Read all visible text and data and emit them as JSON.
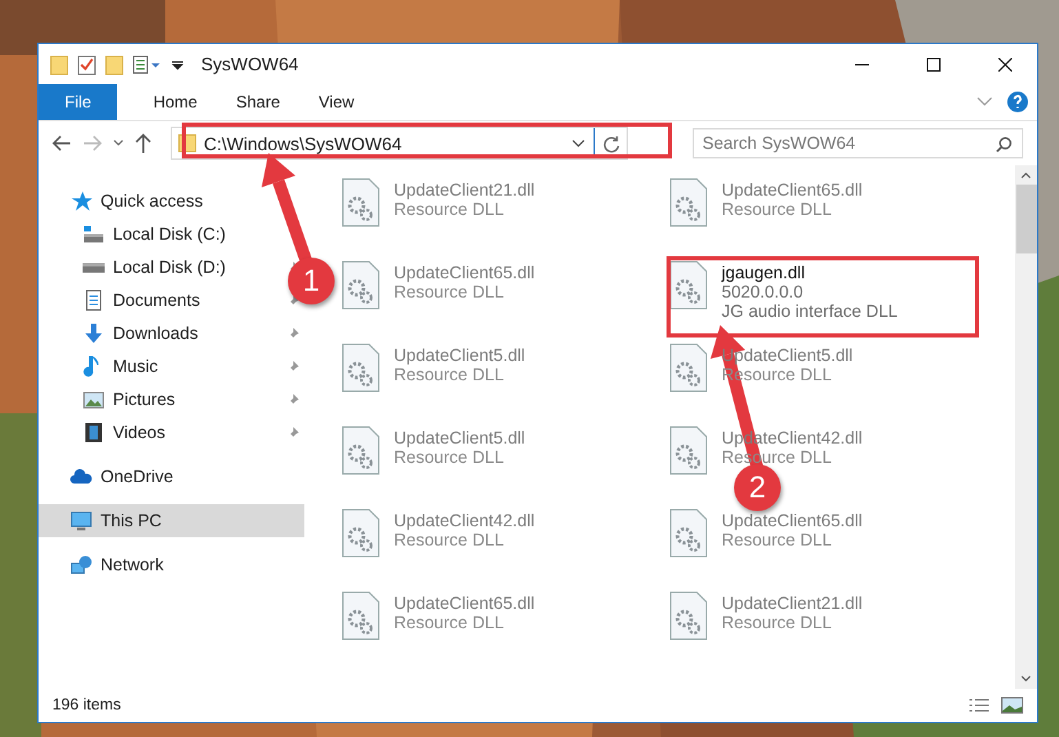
{
  "window": {
    "title": "SysWOW64"
  },
  "ribbon_tabs": [
    {
      "label": "File",
      "kind": "file"
    },
    {
      "label": "Home",
      "kind": "tab",
      "selected": false
    },
    {
      "label": "Share",
      "kind": "tab",
      "selected": false
    },
    {
      "label": "View",
      "kind": "tab",
      "selected": false
    }
  ],
  "address_bar": {
    "path": "C:\\Windows\\SysWOW64"
  },
  "search": {
    "placeholder": "Search SysWOW64"
  },
  "sidebar": {
    "items": [
      {
        "label": "Quick access",
        "kind": "group",
        "selected": false
      },
      {
        "label": "Local Disk (C:)",
        "kind": "item",
        "pinned": false,
        "selected": false
      },
      {
        "label": "Local Disk (D:)",
        "kind": "item",
        "pinned": true,
        "selected": false
      },
      {
        "label": "Documents",
        "kind": "item",
        "pinned": true,
        "selected": false
      },
      {
        "label": "Downloads",
        "kind": "item",
        "pinned": true,
        "selected": false
      },
      {
        "label": "Music",
        "kind": "item",
        "pinned": true,
        "selected": false
      },
      {
        "label": "Pictures",
        "kind": "item",
        "pinned": true,
        "selected": false
      },
      {
        "label": "Videos",
        "kind": "item",
        "pinned": true,
        "selected": false
      },
      {
        "label": "OneDrive",
        "kind": "group",
        "selected": false
      },
      {
        "label": "This PC",
        "kind": "group",
        "selected": true
      },
      {
        "label": "Network",
        "kind": "group",
        "selected": false
      }
    ]
  },
  "files": [
    {
      "name": "UpdateClient21.dll",
      "lines": [
        "Resource DLL"
      ],
      "faded": true
    },
    {
      "name": "UpdateClient65.dll",
      "lines": [
        "Resource DLL"
      ],
      "faded": true
    },
    {
      "name": "UpdateClient65.dll",
      "lines": [
        "Resource DLL"
      ],
      "faded": true
    },
    {
      "name": "jgaugen.dll",
      "lines": [
        "5020.0.0.0",
        "JG audio interface DLL"
      ],
      "faded": false
    },
    {
      "name": "UpdateClient5.dll",
      "lines": [
        "Resource DLL"
      ],
      "faded": true
    },
    {
      "name": "UpdateClient5.dll",
      "lines": [
        "Resource DLL"
      ],
      "faded": true
    },
    {
      "name": "UpdateClient5.dll",
      "lines": [
        "Resource DLL"
      ],
      "faded": true
    },
    {
      "name": "UpdateClient42.dll",
      "lines": [
        "Resource DLL"
      ],
      "faded": true
    },
    {
      "name": "UpdateClient42.dll",
      "lines": [
        "Resource DLL"
      ],
      "faded": true
    },
    {
      "name": "UpdateClient65.dll",
      "lines": [
        "Resource DLL"
      ],
      "faded": true
    },
    {
      "name": "UpdateClient65.dll",
      "lines": [
        "Resource DLL"
      ],
      "faded": true
    },
    {
      "name": "UpdateClient21.dll",
      "lines": [
        "Resource DLL"
      ],
      "faded": true
    }
  ],
  "status_bar": {
    "count": "196 items"
  },
  "annotations": [
    {
      "kind": "box"
    },
    {
      "kind": "box"
    },
    {
      "kind": "arrow",
      "badge": "1"
    },
    {
      "kind": "arrow",
      "badge": "2"
    }
  ]
}
